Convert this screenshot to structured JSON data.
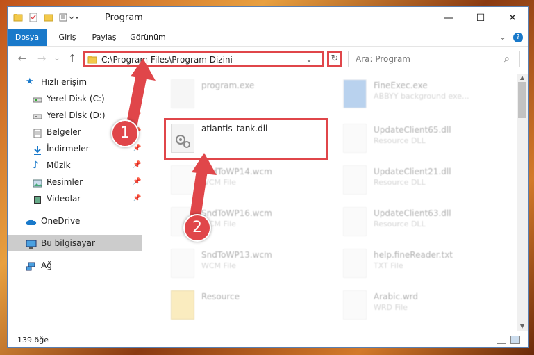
{
  "window": {
    "title": "Program",
    "controls": {
      "minimize": "—",
      "maximize": "☐",
      "close": "✕"
    }
  },
  "ribbon": {
    "tabs": [
      {
        "label": "Dosya",
        "active": true
      },
      {
        "label": "Giriş"
      },
      {
        "label": "Paylaş"
      },
      {
        "label": "Görünüm"
      }
    ],
    "expand_icon": "chevron-down",
    "help_icon": "?"
  },
  "nav": {
    "back": "←",
    "forward": "→",
    "dropdown": "⌄",
    "up": "↑",
    "address": "C:\\Program Files\\Program Dizini",
    "address_dropdown": "⌄",
    "refresh": "↻",
    "search_placeholder": "Ara: Program",
    "search_icon": "⌕"
  },
  "sidebar": {
    "items": [
      {
        "label": "Hızlı erişim",
        "icon": "star-icon",
        "pinned": false
      },
      {
        "label": "Yerel Disk (C:)",
        "icon": "drive-icon",
        "pinned": true
      },
      {
        "label": "Yerel Disk (D:)",
        "icon": "drive-icon",
        "pinned": true
      },
      {
        "label": "Belgeler",
        "icon": "documents-icon",
        "pinned": true
      },
      {
        "label": "İndirmeler",
        "icon": "download-icon",
        "pinned": true
      },
      {
        "label": "Müzik",
        "icon": "music-icon",
        "pinned": true
      },
      {
        "label": "Resimler",
        "icon": "pictures-icon",
        "pinned": true
      },
      {
        "label": "Videolar",
        "icon": "videos-icon",
        "pinned": true
      },
      {
        "label": "OneDrive",
        "icon": "cloud-icon",
        "pinned": false
      },
      {
        "label": "Bu bilgisayar",
        "icon": "computer-icon",
        "pinned": false,
        "selected": true
      },
      {
        "label": "Ağ",
        "icon": "network-icon",
        "pinned": false
      }
    ]
  },
  "files": {
    "left": [
      {
        "name": "program.exe",
        "type": "",
        "dim": true
      },
      {
        "name": "atlantis_tank.dll",
        "type": "",
        "dim": false,
        "highlighted": true
      },
      {
        "name": "SndToWP14.wcm",
        "type": "WCM File",
        "dim": true
      },
      {
        "name": "SndToWP16.wcm",
        "type": "WCM File",
        "dim": true
      },
      {
        "name": "SndToWP13.wcm",
        "type": "WCM File",
        "dim": true
      },
      {
        "name": "Resource",
        "type": "",
        "dim": true
      }
    ],
    "right": [
      {
        "name": "FineExec.exe",
        "type": "ABBYY background exe...",
        "dim": true
      },
      {
        "name": "UpdateClient65.dll",
        "type": "Resource DLL",
        "dim": true
      },
      {
        "name": "UpdateClient21.dll",
        "type": "Resource DLL",
        "dim": true
      },
      {
        "name": "UpdateClient63.dll",
        "type": "Resource DLL",
        "dim": true
      },
      {
        "name": "help.fineReader.txt",
        "type": "TXT File",
        "dim": true
      },
      {
        "name": "Arabic.wrd",
        "type": "WRD File",
        "dim": true
      }
    ]
  },
  "status": {
    "count": "139 öğe"
  },
  "annotations": {
    "badge1": "1",
    "badge2": "2",
    "color": "#e0464a"
  }
}
